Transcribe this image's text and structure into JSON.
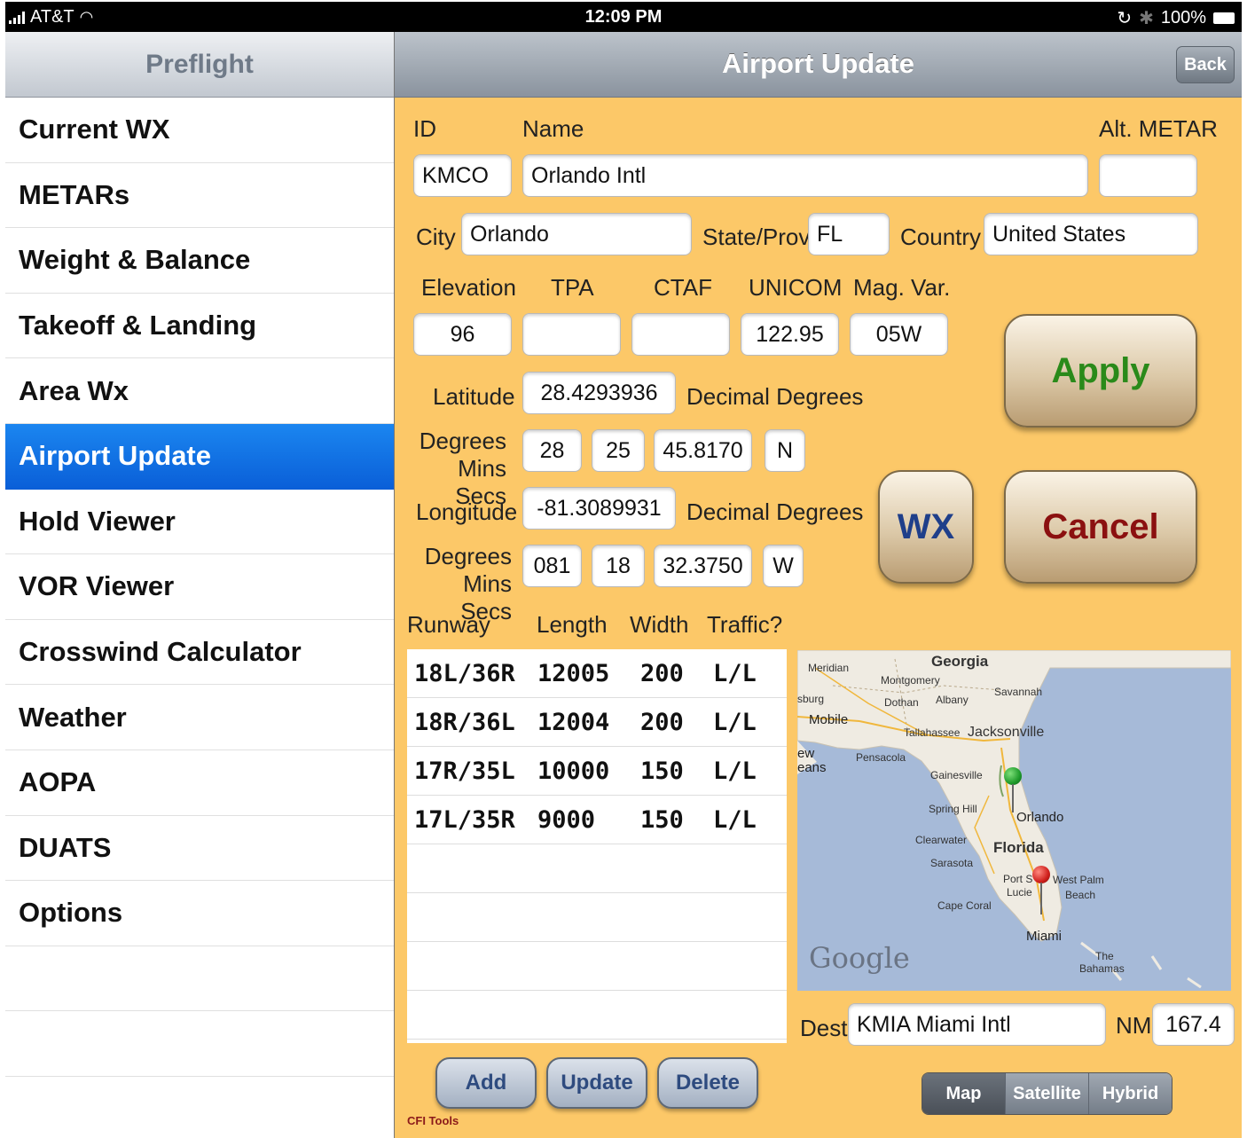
{
  "status_bar": {
    "carrier": "AT&T",
    "time": "12:09 PM",
    "battery": "100%"
  },
  "left_panel": {
    "title": "Preflight",
    "items": [
      {
        "label": "Current WX"
      },
      {
        "label": "METARs"
      },
      {
        "label": "Weight & Balance"
      },
      {
        "label": "Takeoff & Landing"
      },
      {
        "label": "Area Wx"
      },
      {
        "label": "Airport Update",
        "selected": true
      },
      {
        "label": "Hold Viewer"
      },
      {
        "label": "VOR Viewer"
      },
      {
        "label": "Crosswind Calculator"
      },
      {
        "label": "Weather"
      },
      {
        "label": "AOPA"
      },
      {
        "label": "DUATS"
      },
      {
        "label": "Options"
      }
    ]
  },
  "header": {
    "title": "Airport Update",
    "back_label": "Back"
  },
  "form": {
    "id_label": "ID",
    "id_value": "KMCO",
    "name_label": "Name",
    "name_value": "Orlando Intl",
    "alt_metar_label": "Alt. METAR",
    "alt_metar_value": "",
    "city_label": "City",
    "city_value": "Orlando",
    "state_label": "State/Prov",
    "state_value": "FL",
    "country_label": "Country",
    "country_value": "United States",
    "elevation_label": "Elevation",
    "elevation_value": "96",
    "tpa_label": "TPA",
    "tpa_value": "",
    "ctaf_label": "CTAF",
    "ctaf_value": "",
    "unicom_label": "UNICOM",
    "unicom_value": "122.95",
    "magvar_label": "Mag. Var.",
    "magvar_value": "05W",
    "latitude_label": "Latitude",
    "latitude_value": "28.4293936",
    "decimal_degrees_label": "Decimal Degrees",
    "dms_label_1": "Degrees",
    "dms_label_2": "Mins Secs",
    "lat_deg": "28",
    "lat_min": "25",
    "lat_sec": "45.8170",
    "lat_hem": "N",
    "longitude_label": "Longitude",
    "longitude_value": "-81.3089931",
    "lon_deg": "081",
    "lon_min": "18",
    "lon_sec": "32.3750",
    "lon_hem": "W"
  },
  "actions": {
    "apply": "Apply",
    "wx": "WX",
    "cancel": "Cancel",
    "add": "Add",
    "update": "Update",
    "delete": "Delete"
  },
  "runways": {
    "headers": [
      "Runway",
      "Length",
      "Width",
      "Traffic?"
    ],
    "rows": [
      {
        "runway": "18L/36R",
        "length": "12005",
        "width": "200",
        "traffic": "L/L"
      },
      {
        "runway": "18R/36L",
        "length": "12004",
        "width": "200",
        "traffic": "L/L"
      },
      {
        "runway": "17R/35L",
        "length": "10000",
        "width": "150",
        "traffic": "L/L"
      },
      {
        "runway": "17L/35R",
        "length": "9000",
        "width": "150",
        "traffic": "L/L"
      }
    ]
  },
  "map": {
    "labels": {
      "georgia": "Georgia",
      "meridian": "Meridian",
      "montgomery": "Montgomery",
      "savannah": "Savannah",
      "dothan": "Dothan",
      "albany": "Albany",
      "burg": "sburg",
      "mobile": "Mobile",
      "tallahassee": "Tallahassee",
      "jacksonville": "Jacksonville",
      "ew": "ew",
      "eans": "eans",
      "pensacola": "Pensacola",
      "gainesville": "Gainesville",
      "spring_hill": "Spring Hill",
      "orlando": "Orlando",
      "clearwater": "Clearwater",
      "florida": "Florida",
      "sarasota": "Sarasota",
      "port": "Port S",
      "lucie": "Lucie",
      "west_palm": "West Palm",
      "beach": "Beach",
      "cape_coral": "Cape Coral",
      "miami": "Miami",
      "the": "The",
      "bahamas": "Bahamas",
      "google": "Google"
    },
    "origin_pin_color": "#1e9a2a",
    "dest_pin_color": "#d0201c"
  },
  "dest": {
    "label": "Dest",
    "value": "KMIA Miami Intl",
    "nm_label": "NM",
    "nm_value": "167.4"
  },
  "map_type": {
    "options": [
      "Map",
      "Satellite",
      "Hybrid"
    ],
    "selected": "Map"
  },
  "footer": {
    "brand": "CFI Tools"
  },
  "colors": {
    "panel_bg": "#fcc868",
    "selected_row": "#0a66dd",
    "apply_text": "#2a8a1a",
    "wx_text": "#1f3f8a",
    "cancel_text": "#8b1010"
  }
}
